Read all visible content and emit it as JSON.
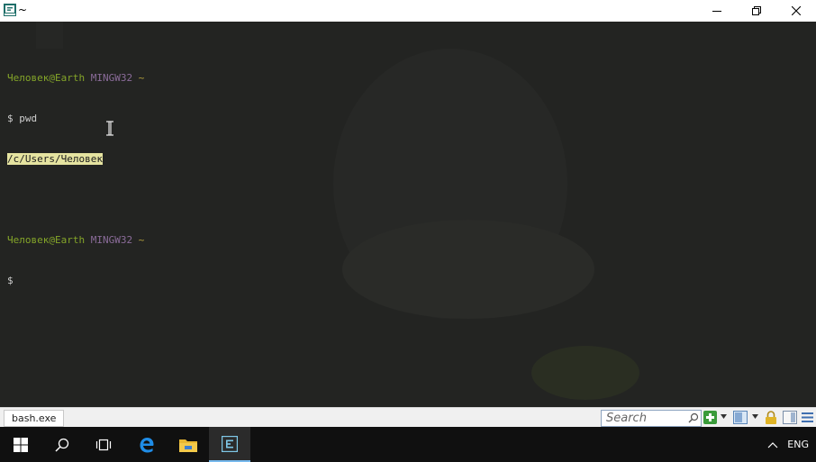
{
  "window": {
    "title": "~",
    "icon": "terminal-app-icon",
    "controls": [
      "minimize-icon",
      "restore-icon",
      "close-icon"
    ]
  },
  "terminal": {
    "prompt1": {
      "user": "Человек@Earth",
      "host": "MINGW32",
      "dir": "~"
    },
    "cmd1": "$ pwd",
    "output1": "/c/Users/Человек",
    "prompt2": {
      "user": "Человек@Earth",
      "host": "MINGW32",
      "dir": "~"
    },
    "cmd2": "$"
  },
  "statusbar": {
    "tab_label": "bash.exe",
    "search_placeholder": "Search",
    "icons": [
      "search-icon",
      "add-tab-icon",
      "dropdown-icon",
      "view-icon",
      "dropdown-icon",
      "lock-icon",
      "panel-icon",
      "menu-icon"
    ]
  },
  "taskbar": {
    "items": [
      "start-icon",
      "search-icon",
      "task-view-icon",
      "edge-icon",
      "file-explorer-icon",
      "terminal-icon"
    ],
    "tray_language": "ENG",
    "tray_chevron": "^"
  },
  "colors": {
    "terminal_bg": "#232422",
    "user": "#84a529",
    "host": "#8b6c9a",
    "tilde": "#b3a03c",
    "highlight": "#e5e3a0",
    "taskbar_bg": "#101010"
  }
}
